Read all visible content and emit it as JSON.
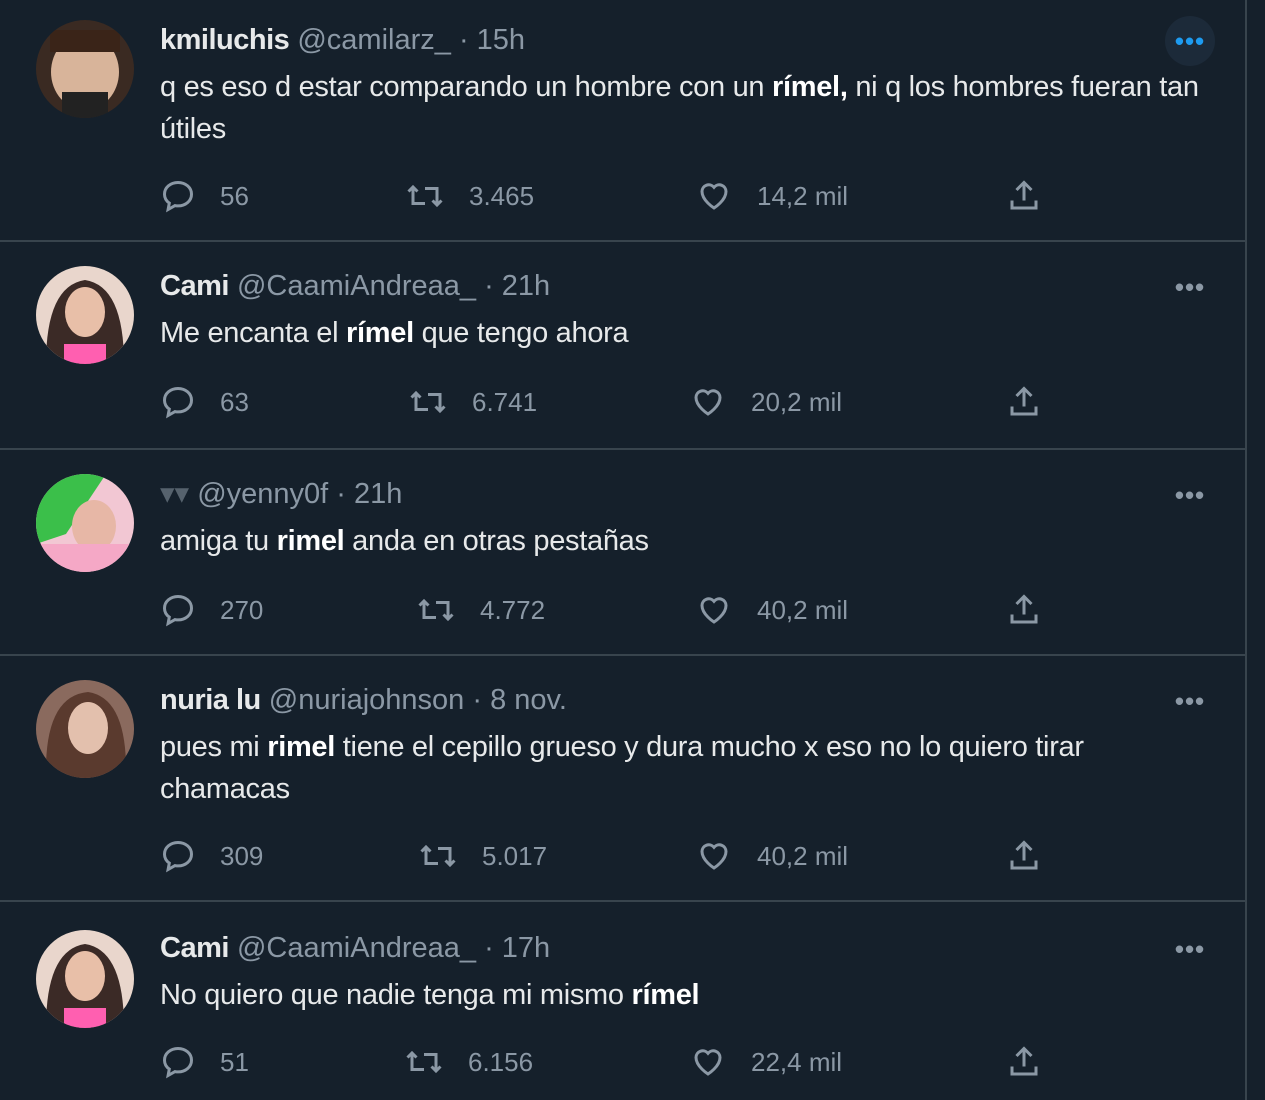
{
  "tweets": [
    {
      "name": "kmiluchis",
      "handle": "@camilarz_",
      "time": "15h",
      "text_parts": [
        "q es eso d estar comparando un hombre con un ",
        "rímel,",
        " ni q los hombres fueran tan útiles"
      ],
      "replies": "56",
      "retweets": "3.465",
      "likes": "14,2 mil",
      "avatar_color": "#c9a28a"
    },
    {
      "name": "Cami",
      "handle": "@CaamiAndreaa_",
      "time": "21h",
      "text_parts": [
        "Me encanta el ",
        "rímel",
        " que tengo ahora"
      ],
      "replies": "63",
      "retweets": "6.741",
      "likes": "20,2 mil",
      "avatar_color": "#e8b8a8"
    },
    {
      "name": "",
      "handle": "@yenny0f",
      "time": "21h",
      "text_parts": [
        "amiga tu ",
        "rimel",
        " anda en otras pestañas"
      ],
      "replies": "270",
      "retweets": "4.772",
      "likes": "40,2 mil",
      "avatar_color": "#3bbf4a"
    },
    {
      "name": "nuria lu",
      "handle": "@nuriajohnson",
      "time": "8 nov.",
      "text_parts": [
        "pues mi ",
        "rimel",
        " tiene el cepillo grueso y dura mucho x eso no lo quiero tirar chamacas"
      ],
      "replies": "309",
      "retweets": "5.017",
      "likes": "40,2 mil",
      "avatar_color": "#b08a7a"
    },
    {
      "name": "Cami",
      "handle": "@CaamiAndreaa_",
      "time": "17h",
      "text_parts": [
        "No quiero que nadie tenga mi mismo ",
        "rímel",
        ""
      ],
      "replies": "51",
      "retweets": "6.156",
      "likes": "22,4 mil",
      "avatar_color": "#e8b8a8"
    }
  ],
  "dot_separator": "·",
  "more_label": "•••",
  "icons": {
    "reply": "reply-icon",
    "retweet": "retweet-icon",
    "like": "heart-icon",
    "share": "share-icon",
    "more": "more-icon"
  },
  "colors": {
    "background": "#15202b",
    "border": "#38444d",
    "muted": "#8b98a5",
    "accent": "#1d9bf0"
  }
}
